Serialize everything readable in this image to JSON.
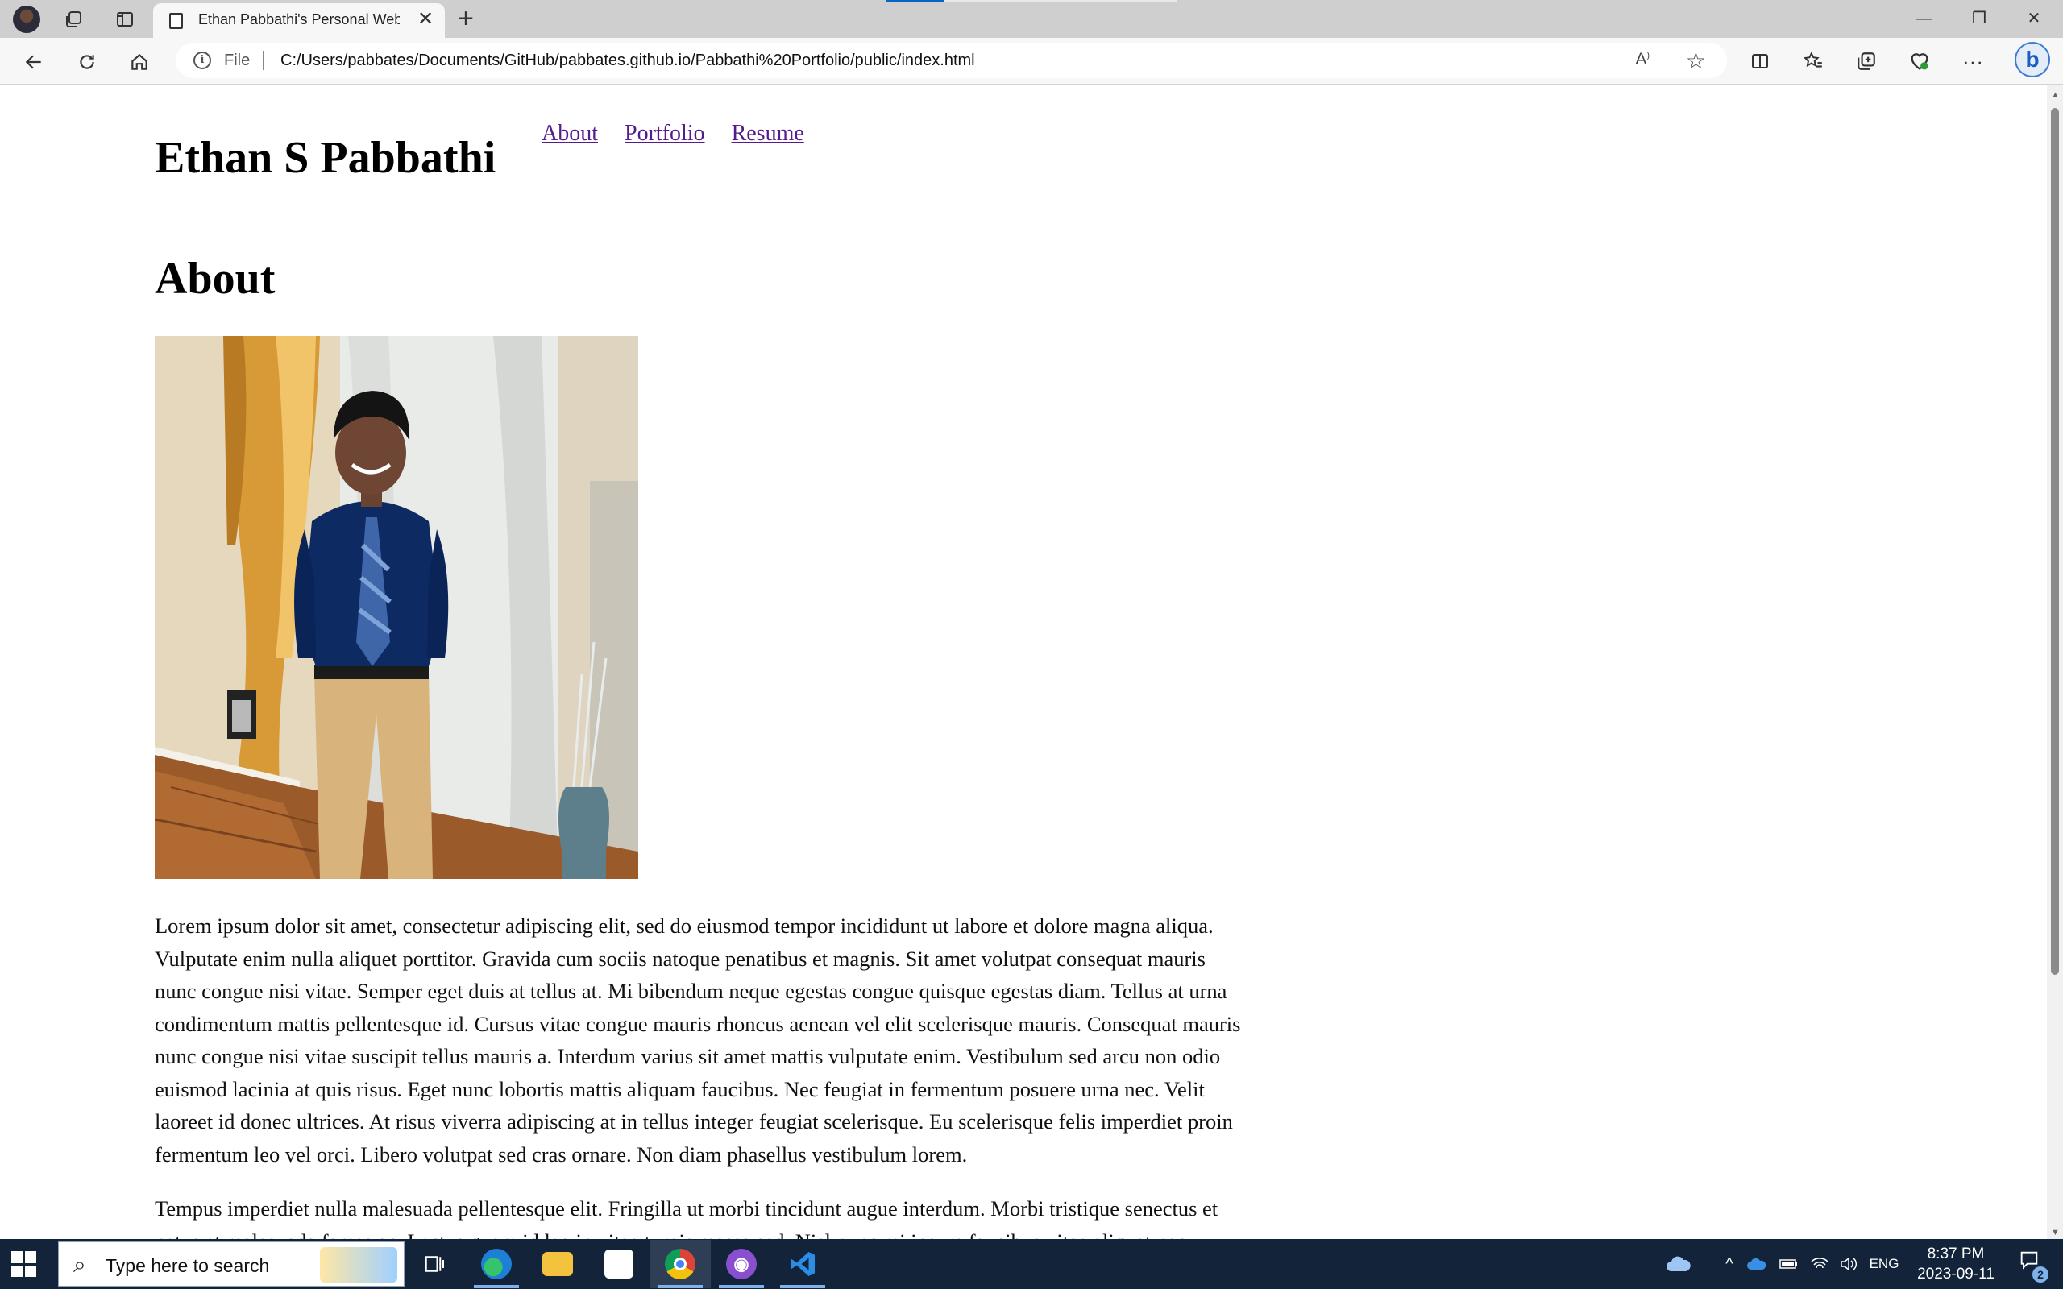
{
  "browser": {
    "tab": {
      "title": "Ethan Pabbathi's Personal Websi"
    },
    "address_bar": {
      "file_label": "File",
      "url": "C:/Users/pabbates/Documents/GitHub/pabbates.github.io/Pabbathi%20Portfolio/public/index.html"
    },
    "window_controls": {
      "minimize": "—",
      "restore": "❐",
      "close": "✕"
    }
  },
  "page": {
    "site_name": "Ethan S Pabbathi",
    "nav": [
      {
        "label": "About"
      },
      {
        "label": "Portfolio"
      },
      {
        "label": "Resume"
      }
    ],
    "section_heading": "About",
    "paragraphs": [
      "Lorem ipsum dolor sit amet, consectetur adipiscing elit, sed do eiusmod tempor incididunt ut labore et dolore magna aliqua. Vulputate enim nulla aliquet porttitor. Gravida cum sociis natoque penatibus et magnis. Sit amet volutpat consequat mauris nunc congue nisi vitae. Semper eget duis at tellus at. Mi bibendum neque egestas congue quisque egestas diam. Tellus at urna condimentum mattis pellentesque id. Cursus vitae congue mauris rhoncus aenean vel elit scelerisque mauris. Consequat mauris nunc congue nisi vitae suscipit tellus mauris a. Interdum varius sit amet mattis vulputate enim. Vestibulum sed arcu non odio euismod lacinia at quis risus. Eget nunc lobortis mattis aliquam faucibus. Nec feugiat in fermentum posuere urna nec. Velit laoreet id donec ultrices. At risus viverra adipiscing at in tellus integer feugiat scelerisque. Eu scelerisque felis imperdiet proin fermentum leo vel orci. Libero volutpat sed cras ornare. Non diam phasellus vestibulum lorem.",
      "Tempus imperdiet nulla malesuada pellentesque elit. Fringilla ut morbi tincidunt augue interdum. Morbi tristique senectus et netus et malesuada fames ac. Lectus quam id leo in vitae turpis massa sed. Nisl nunc mi ipsum faucibus vitae aliquet nec ullamcorper sit amet risus nullam eget felis eget nunc lobortis mattis aliquam faucibus purus in massa tempor nec."
    ]
  },
  "taskbar": {
    "search_placeholder": "Type here to search",
    "language": "ENG",
    "time": "8:37 PM",
    "date": "2023-09-11",
    "notification_count": "2"
  },
  "colors": {
    "link_visited": "#551a8b",
    "taskbar_bg": "#12233a",
    "tab_active_bg": "#f7f7f7",
    "tabbar_bg": "#cfcfcf"
  },
  "icons": [
    "profile-avatar-icon",
    "workspaces-icon",
    "vertical-tabs-icon",
    "page-icon",
    "back-icon",
    "refresh-icon",
    "home-icon",
    "info-icon",
    "read-aloud-icon",
    "favorite-star-icon",
    "split-screen-icon",
    "favorites-icon",
    "collections-icon",
    "browser-essentials-icon",
    "more-icon",
    "bing-copilot-icon",
    "windows-start-icon",
    "search-icon",
    "task-view-icon",
    "edge-icon",
    "file-explorer-icon",
    "store-icon",
    "chrome-icon",
    "github-desktop-icon",
    "vscode-icon",
    "onedrive-icon",
    "chevron-up-icon",
    "battery-icon",
    "wifi-icon",
    "volume-icon",
    "notification-icon"
  ]
}
